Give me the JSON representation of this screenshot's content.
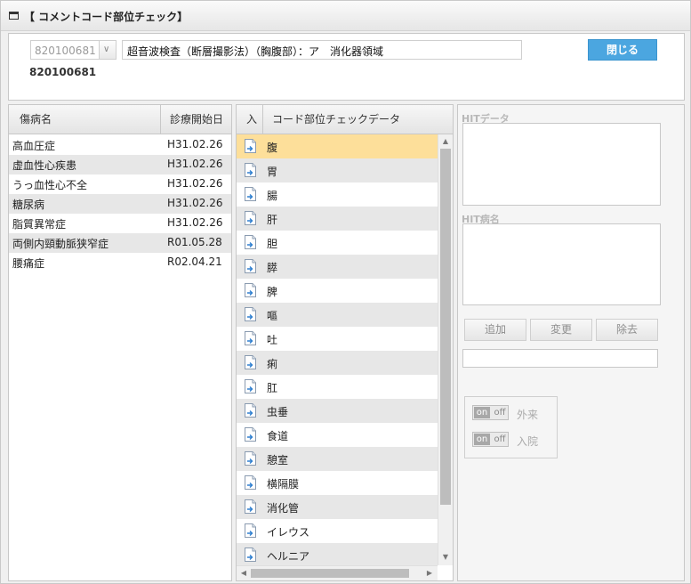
{
  "title": "【 コメントコード部位チェック】",
  "header": {
    "code_select_value": "820100681",
    "exam_name": "超音波検査（断層撮影法）（胸腹部）：ア　消化器領域",
    "close_label": "閉じる",
    "code_display": "820100681"
  },
  "disease_table": {
    "columns": [
      "傷病名",
      "診療開始日"
    ],
    "rows": [
      {
        "name": "高血圧症",
        "date": "H31.02.26"
      },
      {
        "name": "虚血性心疾患",
        "date": "H31.02.26"
      },
      {
        "name": "うっ血性心不全",
        "date": "H31.02.26"
      },
      {
        "name": "糖尿病",
        "date": "H31.02.26"
      },
      {
        "name": "脂質異常症",
        "date": "H31.02.26"
      },
      {
        "name": "両側内頸動脈狭窄症",
        "date": "R01.05.28"
      },
      {
        "name": "腰痛症",
        "date": "R02.04.21"
      }
    ]
  },
  "code_table": {
    "col_in": "入",
    "col_data": "コード部位チェックデータ",
    "rows": [
      "腹",
      "胃",
      "腸",
      "肝",
      "胆",
      "膵",
      "脾",
      "嘔",
      "吐",
      "痢",
      "肛",
      "虫垂",
      "食道",
      "憩室",
      "横隔膜",
      "消化管",
      "イレウス",
      "ヘルニア"
    ],
    "selected_index": 0
  },
  "right": {
    "hit_data_label": "HITデータ",
    "hit_disease_label": "HIT病名",
    "add_label": "追加",
    "change_label": "変更",
    "remove_label": "除去",
    "toggle_on": "on",
    "toggle_off": "off",
    "outpatient_label": "外来",
    "inpatient_label": "入院"
  }
}
